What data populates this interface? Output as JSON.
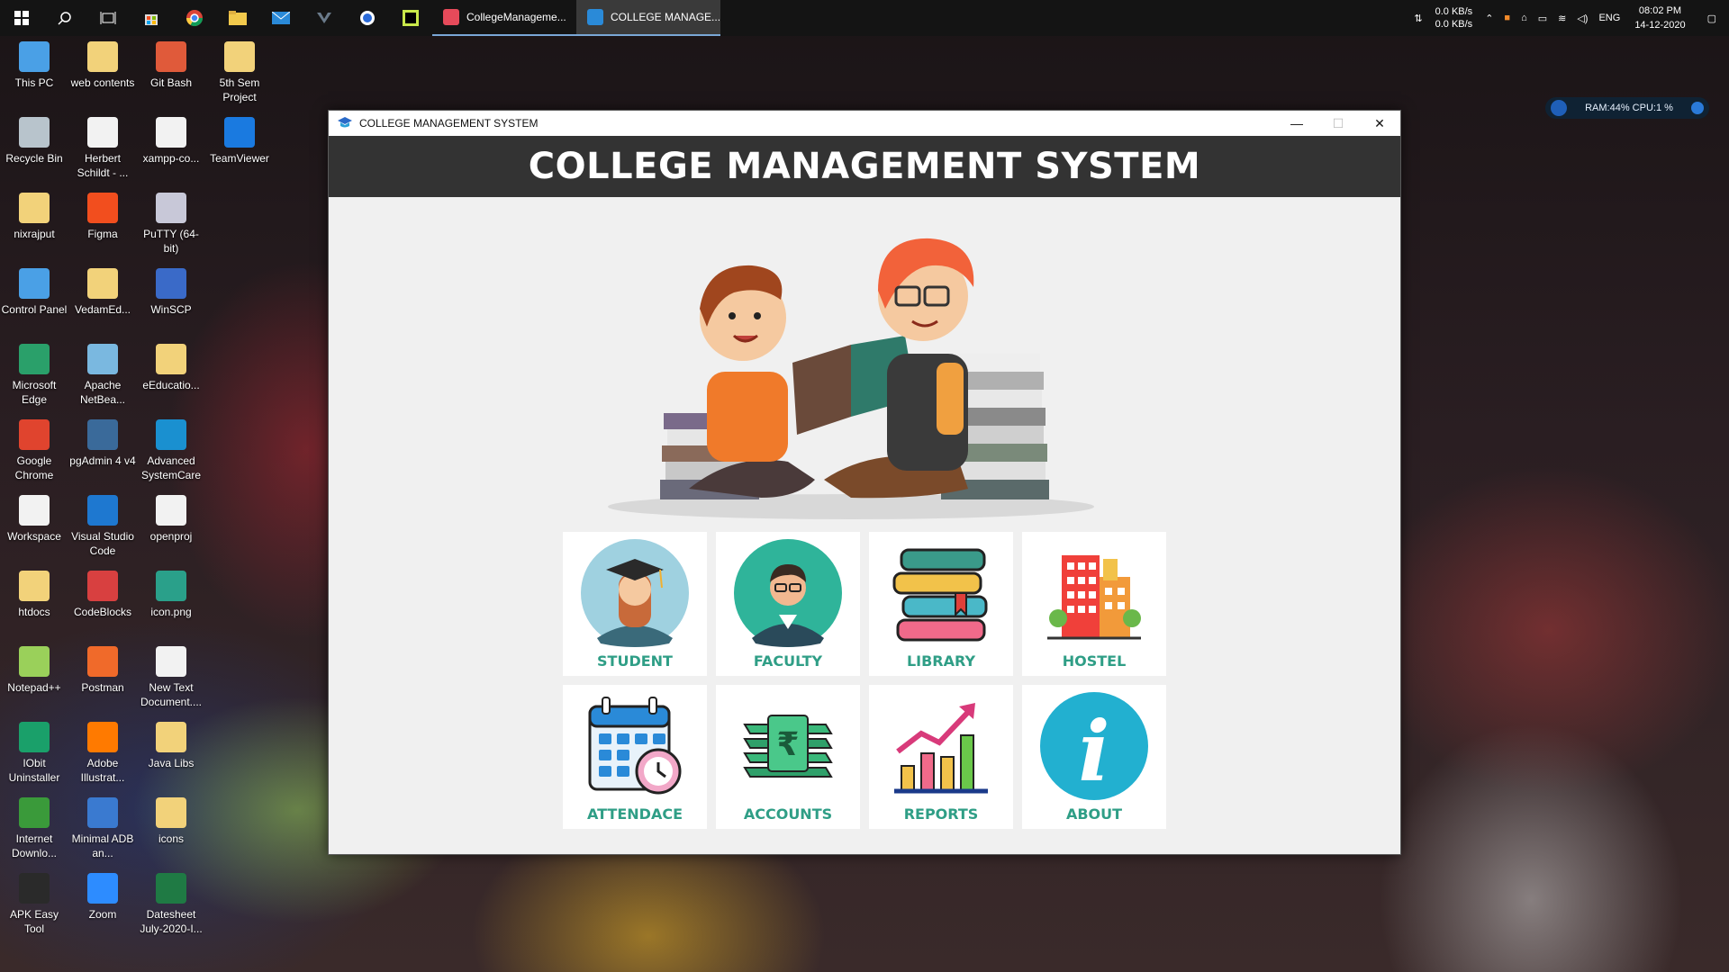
{
  "taskbar": {
    "apps": [
      {
        "label": "CollegeManageme...",
        "icon": "app-icon",
        "color": "#e64a5a"
      },
      {
        "label": "COLLEGE MANAGE...",
        "icon": "java-window-icon",
        "color": "#2a8ad8"
      }
    ],
    "net_up": "0.0 KB/s",
    "net_down": "0.0 KB/s",
    "lang": "ENG",
    "time": "08:02 PM",
    "date": "14-12-2020"
  },
  "ram_widget": {
    "text": "RAM:44%  CPU:1 %"
  },
  "desktop": {
    "icons": [
      {
        "label": "This PC",
        "color": "#4aa0e6"
      },
      {
        "label": "web contents",
        "color": "#f2d27a"
      },
      {
        "label": "Git Bash",
        "color": "#e05a3a"
      },
      {
        "label": "5th Sem Project",
        "color": "#f2d27a"
      },
      {
        "label": "Recycle Bin",
        "color": "#b8c4cc"
      },
      {
        "label": "Herbert Schildt - ...",
        "color": "#f2f2f2"
      },
      {
        "label": "xampp-co...",
        "color": "#f2f2f2"
      },
      {
        "label": "TeamViewer",
        "color": "#1a7ae0"
      },
      {
        "label": "nixrajput",
        "color": "#f2d27a"
      },
      {
        "label": "Figma",
        "color": "#f24e1e"
      },
      {
        "label": "PuTTY (64-bit)",
        "color": "#c8c8d8"
      },
      {
        "label": "Control Panel",
        "color": "#4aa0e6"
      },
      {
        "label": "VedamEd...",
        "color": "#f2d27a"
      },
      {
        "label": "WinSCP",
        "color": "#3a6ac8"
      },
      {
        "label": "Microsoft Edge",
        "color": "#2aa06a"
      },
      {
        "label": "Apache NetBea...",
        "color": "#7ab8e0"
      },
      {
        "label": "eEducatio...",
        "color": "#f2d27a"
      },
      {
        "label": "Google Chrome",
        "color": "#e0442e"
      },
      {
        "label": "pgAdmin 4 v4",
        "color": "#3a6a9a"
      },
      {
        "label": "Advanced SystemCare",
        "color": "#1a90d0"
      },
      {
        "label": "Workspace",
        "color": "#f2f2f2"
      },
      {
        "label": "Visual Studio Code",
        "color": "#1e78d0"
      },
      {
        "label": "openproj",
        "color": "#f2f2f2"
      },
      {
        "label": "htdocs",
        "color": "#f2d27a"
      },
      {
        "label": "CodeBlocks",
        "color": "#d84040"
      },
      {
        "label": "icon.png",
        "color": "#2aa08a"
      },
      {
        "label": "Notepad++",
        "color": "#9ad05a"
      },
      {
        "label": "Postman",
        "color": "#f06a2a"
      },
      {
        "label": "New Text Document....",
        "color": "#f2f2f2"
      },
      {
        "label": "IObit Uninstaller",
        "color": "#1aa06a"
      },
      {
        "label": "Adobe Illustrat...",
        "color": "#ff7a00"
      },
      {
        "label": "Java Libs",
        "color": "#f2d27a"
      },
      {
        "label": "Internet Downlo...",
        "color": "#3a9a3a"
      },
      {
        "label": "Minimal ADB an...",
        "color": "#3a7ad0"
      },
      {
        "label": "icons",
        "color": "#f2d27a"
      },
      {
        "label": "APK Easy Tool",
        "color": "#2a2a2a"
      },
      {
        "label": "Zoom",
        "color": "#2d8cff"
      },
      {
        "label": "Datesheet July-2020-I...",
        "color": "#1f7a44"
      }
    ]
  },
  "window": {
    "title": "COLLEGE MANAGEMENT SYSTEM",
    "header": "COLLEGE MANAGEMENT SYSTEM",
    "tiles": [
      {
        "label": "STUDENT",
        "icon": "student-icon"
      },
      {
        "label": "FACULTY",
        "icon": "faculty-icon"
      },
      {
        "label": "LIBRARY",
        "icon": "library-icon"
      },
      {
        "label": "HOSTEL",
        "icon": "hostel-icon"
      },
      {
        "label": "ATTENDACE",
        "icon": "attendance-icon"
      },
      {
        "label": "ACCOUNTS",
        "icon": "accounts-icon"
      },
      {
        "label": "REPORTS",
        "icon": "reports-icon"
      },
      {
        "label": "ABOUT",
        "icon": "about-icon"
      }
    ],
    "accent": "#2f9e86",
    "header_bg": "#333333"
  }
}
